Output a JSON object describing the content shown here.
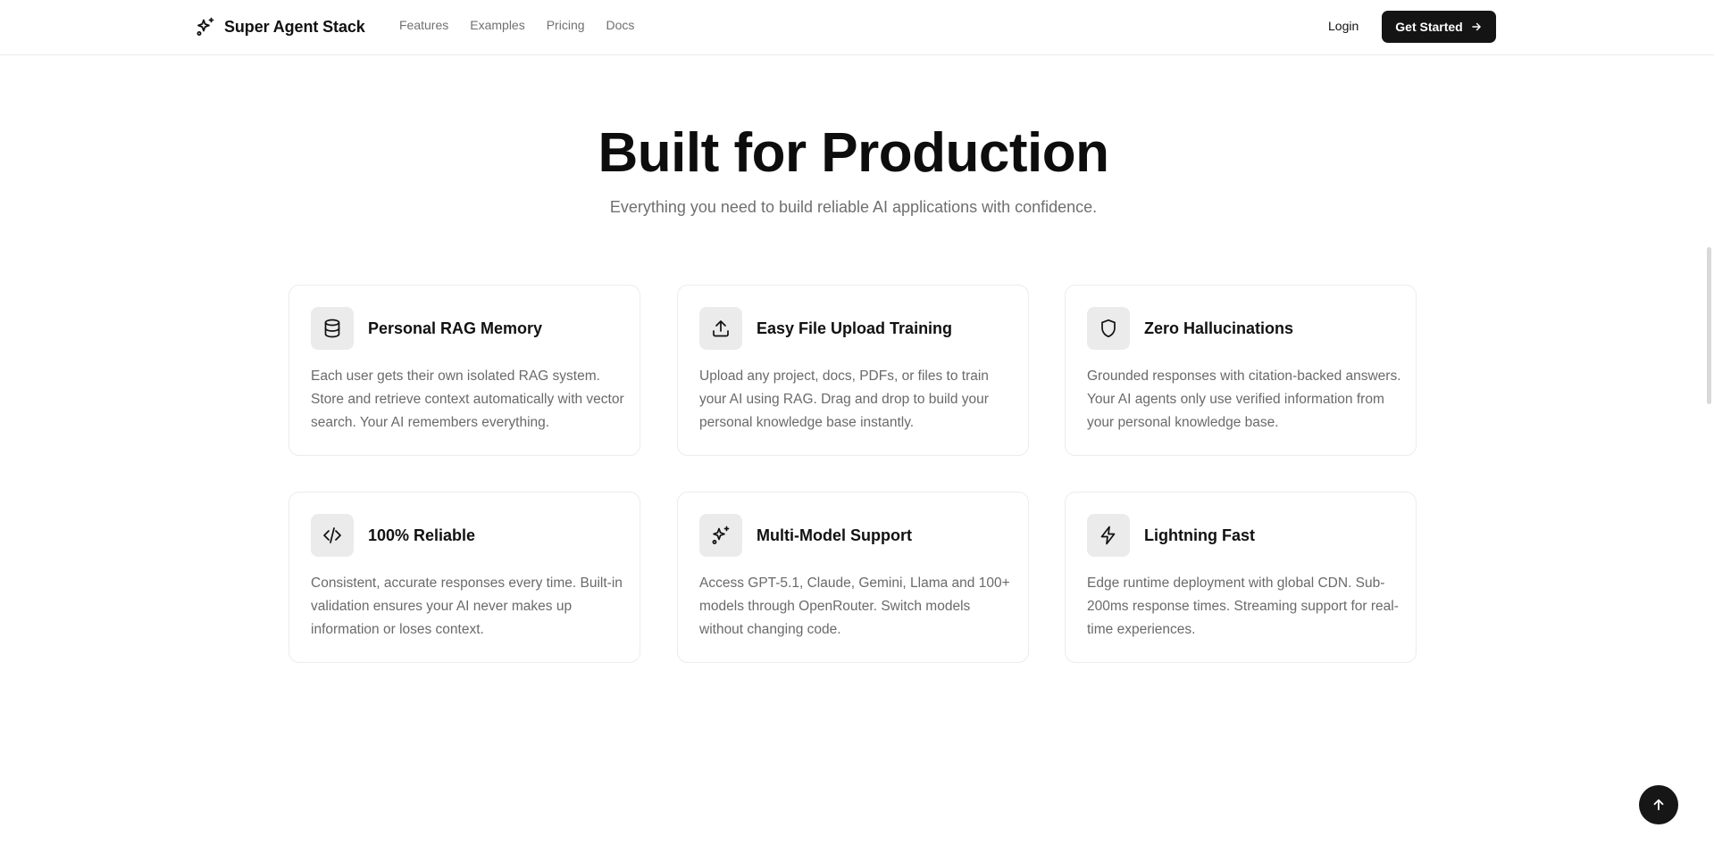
{
  "header": {
    "brand": "Super Agent Stack",
    "nav": [
      "Features",
      "Examples",
      "Pricing",
      "Docs"
    ],
    "login": "Login",
    "cta": "Get Started"
  },
  "hero": {
    "title": "Built for Production",
    "subtitle": "Everything you need to build reliable AI applications with confidence."
  },
  "features": [
    {
      "icon": "database-icon",
      "title": "Personal RAG Memory",
      "description": "Each user gets their own isolated RAG system. Store and retrieve context automatically with vector search. Your AI remembers everything."
    },
    {
      "icon": "upload-icon",
      "title": "Easy File Upload Training",
      "description": "Upload any project, docs, PDFs, or files to train your AI using RAG. Drag and drop to build your personal knowledge base instantly."
    },
    {
      "icon": "shield-icon",
      "title": "Zero Hallucinations",
      "description": "Grounded responses with citation-backed answers. Your AI agents only use verified information from your personal knowledge base."
    },
    {
      "icon": "code-icon",
      "title": "100% Reliable",
      "description": "Consistent, accurate responses every time. Built-in validation ensures your AI never makes up information or loses context."
    },
    {
      "icon": "sparkles-icon",
      "title": "Multi-Model Support",
      "description": "Access GPT-5.1, Claude, Gemini, Llama and 100+ models through OpenRouter. Switch models without changing code."
    },
    {
      "icon": "zap-icon",
      "title": "Lightning Fast",
      "description": "Edge runtime deployment with global CDN. Sub-200ms response times. Streaming support for real-time experiences."
    }
  ],
  "colors": {
    "text": "#111111",
    "muted": "#6a6a6a",
    "button_bg": "#141414",
    "icon_bg": "#ebebeb",
    "border": "#ececec"
  }
}
